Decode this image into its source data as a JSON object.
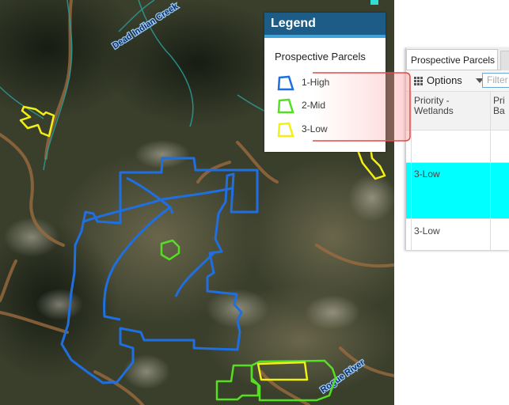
{
  "map": {
    "labels": {
      "creek": "Dead Indian Creek",
      "river": "Rogue River"
    },
    "colors": {
      "high": "#1f6fe0",
      "mid": "#52e021",
      "low": "#f2ef17",
      "stream": "#2a9d9a"
    }
  },
  "legend": {
    "title": "Legend",
    "layer": "Prospective Parcels",
    "items": [
      {
        "label": "1-High",
        "color": "#1f6fe0"
      },
      {
        "label": "2-Mid",
        "color": "#52e021"
      },
      {
        "label": "3-Low",
        "color": "#f2ef17"
      }
    ]
  },
  "table": {
    "tab_label": "Prospective Parcels",
    "options_label": "Options",
    "filter_placeholder": "Filter",
    "icons": [
      "grid-icon",
      "caret-down-icon"
    ],
    "columns": [
      "Priority -\nWetlands",
      "Pri\nBa"
    ],
    "rows": [
      {
        "priority": "",
        "highlight": false
      },
      {
        "priority": "3-Low",
        "highlight": true
      },
      {
        "priority": "3-Low",
        "highlight": false
      }
    ],
    "highlight_color": "#00ffff"
  }
}
